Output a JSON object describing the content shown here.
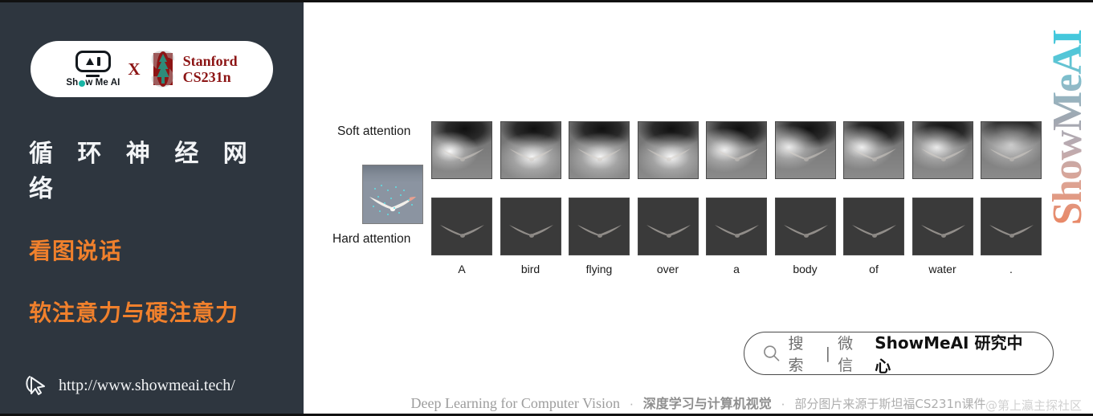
{
  "sidebar": {
    "logo": {
      "showmeai_label": "Show Me AI",
      "cross": "X",
      "stanford_line1": "Stanford",
      "stanford_line2": "CS231n"
    },
    "title": "循 环 神 经 网 络",
    "subtitle_1": "看图说话",
    "subtitle_2": "软注意力与硬注意力",
    "site_url": "http://www.showmeai.tech/",
    "cursor_icon": "cursor-arrow-icon",
    "bg_color": "#2e363f",
    "accent_color": "#f0802c"
  },
  "figure": {
    "row_labels": {
      "soft": "Soft attention",
      "hard": "Hard attention"
    },
    "source_image_alt": "bird-flying-over-water-photo",
    "caption_words": [
      "A",
      "bird",
      "flying",
      "over",
      "a",
      "body",
      "of",
      "water",
      "."
    ]
  },
  "watermark": {
    "vertical_text": "ShowMeAI",
    "bottom_text": "@第上瀛主探社区"
  },
  "search": {
    "icon": "search-icon",
    "placeholder": "搜索",
    "divider": "|",
    "channel": "微信",
    "brand": "ShowMeAI 研究中心"
  },
  "footer": {
    "english": "Deep Learning for Computer Vision",
    "sep1": "·",
    "chinese_bold": "深度学习与计算机视觉",
    "sep2": "·",
    "chinese_note": "部分图片来源于斯坦福CS231n课件"
  },
  "chart_data": {
    "type": "heatmap",
    "title": "Soft vs Hard attention over caption words",
    "rows": [
      "Soft attention",
      "Hard attention"
    ],
    "categories": [
      "A",
      "bird",
      "flying",
      "over",
      "a",
      "body",
      "of",
      "water",
      "."
    ],
    "series": [
      {
        "name": "Soft attention",
        "focus_x": [
          0.3,
          0.52,
          0.52,
          0.55,
          0.3,
          0.22,
          0.3,
          0.4,
          0.5
        ],
        "focus_y": [
          0.52,
          0.62,
          0.62,
          0.62,
          0.5,
          0.45,
          0.45,
          0.45,
          0.4
        ],
        "intensity": [
          0.95,
          0.92,
          0.92,
          0.95,
          0.88,
          0.85,
          0.88,
          0.85,
          0.7
        ],
        "spread": [
          0.45,
          0.55,
          0.55,
          0.55,
          0.5,
          0.5,
          0.5,
          0.5,
          0.55
        ]
      },
      {
        "name": "Hard attention",
        "focus_x": [
          0.5,
          0.72,
          0.5,
          0.5,
          0.26,
          0.32,
          0.52,
          0.56,
          0.56
        ],
        "focus_y": [
          0.78,
          0.28,
          0.8,
          0.8,
          0.78,
          0.26,
          0.84,
          0.84,
          0.84
        ],
        "intensity": [
          1.0,
          1.0,
          0.95,
          0.95,
          1.0,
          1.0,
          0.95,
          0.95,
          0.95
        ],
        "spread": [
          0.16,
          0.15,
          0.15,
          0.15,
          0.15,
          0.15,
          0.14,
          0.14,
          0.14
        ]
      }
    ],
    "grid": false,
    "legend": "none"
  }
}
